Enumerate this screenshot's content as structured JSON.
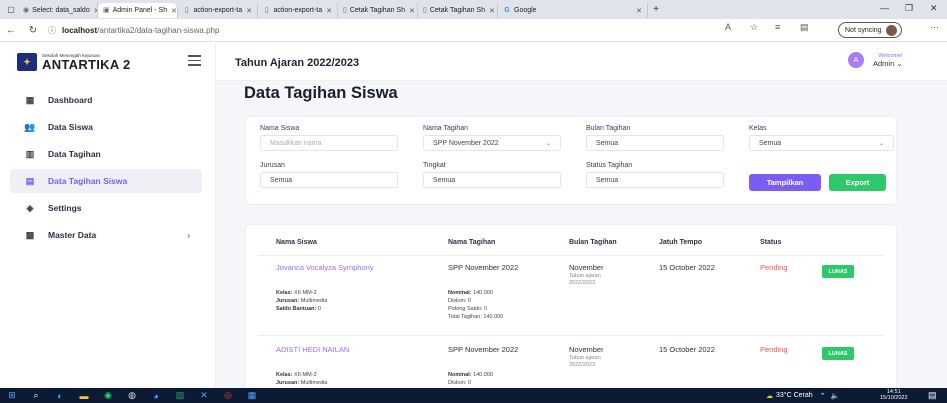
{
  "browser": {
    "tabs": [
      {
        "label": "Select: data_saldo",
        "icon": "database-icon"
      },
      {
        "label": "Admin Panel - Sh",
        "icon": "school-icon",
        "active": true
      },
      {
        "label": "action-export-ta",
        "icon": "page-icon"
      },
      {
        "label": "action-export-ta",
        "icon": "page-icon"
      },
      {
        "label": "Cetak Tagihan Sh",
        "icon": "page-icon"
      },
      {
        "label": "Cetak Tagihan Sh",
        "icon": "page-icon"
      },
      {
        "label": "Google",
        "icon": "google-icon"
      }
    ],
    "url_host": "localhost",
    "url_path": "/antartika2/data-tagihan-siswa.php",
    "sync_label": "Not syncing"
  },
  "sidebar": {
    "brand_small": "Sekolah Menengah Kejuruan",
    "brand_name": "ANTARTIKA 2",
    "items": [
      {
        "label": "Dashboard",
        "icon": "dashboard-icon"
      },
      {
        "label": "Data Siswa",
        "icon": "users-icon"
      },
      {
        "label": "Data Tagihan",
        "icon": "table-icon"
      },
      {
        "label": "Data Tagihan Siswa",
        "icon": "document-icon",
        "active": true
      },
      {
        "label": "Settings",
        "icon": "settings-icon"
      },
      {
        "label": "Master Data",
        "icon": "grid-icon",
        "has_submenu": true
      }
    ]
  },
  "header": {
    "title": "Tahun Ajaran 2022/2023",
    "welcome": "Welcome!",
    "user_name": "Admin",
    "avatar_letter": "A"
  },
  "page": {
    "title": "Data Tagihan Siswa"
  },
  "filters": {
    "nama_siswa_label": "Nama Siswa",
    "nama_siswa_placeholder": "Masukkan nama",
    "nama_tagihan_label": "Nama Tagihan",
    "nama_tagihan_value": "SPP November 2022",
    "bulan_label": "Bulan Tagihan",
    "bulan_value": "Semua",
    "kelas_label": "Kelas",
    "kelas_value": "Semua",
    "jurusan_label": "Jurusan",
    "jurusan_value": "Semua",
    "tingkat_label": "Tingkat",
    "tingkat_value": "Semua",
    "status_label": "Status Tagihan",
    "status_value": "Semua",
    "tampilkan_label": "Tampilkan",
    "export_label": "Export"
  },
  "table": {
    "headers": [
      "Nama Siswa",
      "Nama Tagihan",
      "Bulan Tagihan",
      "Jatuh Tempo",
      "Status"
    ],
    "rows": [
      {
        "name": "Jovanca Vocalyza Symphony",
        "tagihan": "SPP November 2022",
        "bulan": "November",
        "tahun_ajaran": "Tahun ajaran 2022/2023",
        "jatuh_tempo": "15 October 2022",
        "status": "Pending",
        "action": "LUNAS",
        "kelas_label": "Kelas:",
        "kelas": "XII-MM-2",
        "jurusan_label": "Jurusan:",
        "jurusan": "Multimedia",
        "saldo_label": "Saldo Bantuan:",
        "saldo": "0",
        "nominal_label": "Nominal:",
        "nominal": "140.000",
        "diskon_label": "Diskon:",
        "diskon": "0",
        "potong_label": "Potong Saldo:",
        "potong": "0",
        "total_label": "Total Tagihan:",
        "total": "140.000"
      },
      {
        "name": "ADISTI HEDI NAILAN",
        "tagihan": "SPP November 2022",
        "bulan": "November",
        "tahun_ajaran": "Tahun ajaran 2022/2023",
        "jatuh_tempo": "15 October 2022",
        "status": "Pending",
        "action": "LUNAS",
        "kelas_label": "Kelas:",
        "kelas": "XII-MM-2",
        "jurusan_label": "Jurusan:",
        "jurusan": "Multimedia",
        "nominal_label": "Nominal:",
        "nominal": "140.000",
        "diskon_label": "Diskon:",
        "diskon": "0"
      }
    ]
  },
  "taskbar": {
    "weather": "33°C Cerah",
    "time": "14:51",
    "date": "15/10/2022"
  },
  "colors": {
    "accent": "#7b5cf5",
    "export": "#2ec76a",
    "pending": "#ee5555"
  }
}
